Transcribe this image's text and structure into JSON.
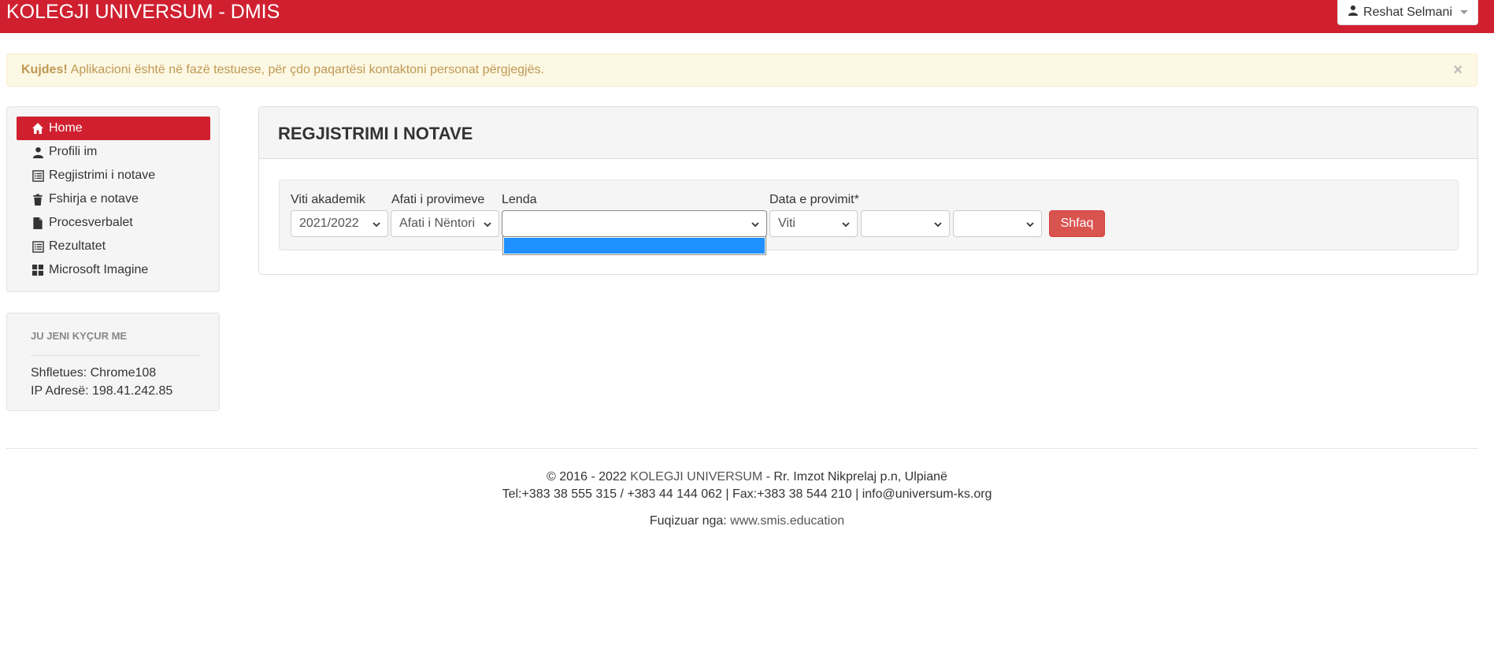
{
  "topbar": {
    "brand": "KOLEGJI UNIVERSUM - DMIS",
    "user_name": "Reshat Selmani",
    "accent_color": "#d02030"
  },
  "alert": {
    "strong": "Kujdes!",
    "message": "Aplikacioni është në fazë testuese, për çdo paqartësi kontaktoni personat përgjegjës.",
    "close": "×"
  },
  "sidebar": {
    "items": [
      {
        "label": "Home",
        "icon": "home-icon",
        "active": true
      },
      {
        "label": "Profili im",
        "icon": "user-icon",
        "active": false
      },
      {
        "label": "Regjistrimi i notave",
        "icon": "list-icon",
        "active": false
      },
      {
        "label": "Fshirja e notave",
        "icon": "trash-icon",
        "active": false
      },
      {
        "label": "Procesverbalet",
        "icon": "file-icon",
        "active": false
      },
      {
        "label": "Rezultatet",
        "icon": "list-icon",
        "active": false
      },
      {
        "label": "Microsoft Imagine",
        "icon": "windows-icon",
        "active": false
      }
    ]
  },
  "session_info": {
    "title": "JU JENI KYÇUR ME",
    "browser": "Shfletues: Chrome108",
    "ip": "IP Adresë: 198.41.242.85"
  },
  "panel": {
    "title": "REGJISTRIMI I NOTAVE",
    "filters": {
      "academic_year_label": "Viti akademik",
      "academic_year_value": "2021/2022",
      "exam_period_label": "Afati i provimeve",
      "exam_period_value": "Afati i Nëntori",
      "subject_label": "Lenda",
      "subject_value": "",
      "exam_date_label": "Data e provimit*",
      "year_value": "Viti",
      "month_value": "",
      "day_value": ""
    },
    "show_button": "Shfaq"
  },
  "footer": {
    "copyright_prefix": "© 2016 - 2022",
    "org_link": "KOLEGJI UNIVERSUM",
    "address": "- Rr. Imzot Nikprelaj p.n, Ulpianë",
    "contacts": "Tel:+383 38 555 315 / +383 44 144 062 | Fax:+383 38 544 210 | info@universum-ks.org",
    "powered_prefix": "Fuqizuar nga:",
    "powered_link": "www.smis.education"
  }
}
